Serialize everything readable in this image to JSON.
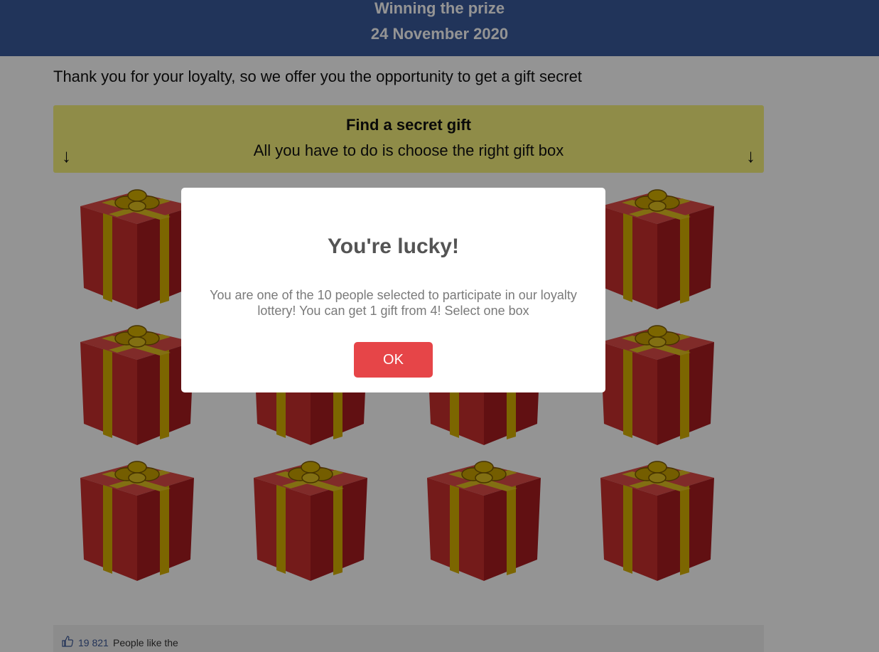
{
  "header": {
    "title": "Winning the prize",
    "date": "24 November 2020"
  },
  "intro_text": "Thank you for your loyalty, so we offer you the opportunity to get a gift secret",
  "banner": {
    "title": "Find a secret gift",
    "subtitle": "All you have to do is choose the right gift box",
    "left_arrow": "↓",
    "right_arrow": "↓"
  },
  "gifts": {
    "icon": "gift-box-icon",
    "count": 12
  },
  "likes": {
    "icon": "thumbs-up-icon",
    "count": "19 821",
    "text": "People like the"
  },
  "modal": {
    "title": "You're lucky!",
    "message": "You are one of the 10 people selected to participate in our loyalty lottery! You can get 1 gift from 4! Select one box",
    "ok_label": "OK"
  },
  "colors": {
    "header_bg": "#3a5a9b",
    "banner_bg": "#f6f17d",
    "ok_button": "#e64548",
    "gift_red": "#c0292b",
    "gift_ribbon": "#d6b000"
  }
}
